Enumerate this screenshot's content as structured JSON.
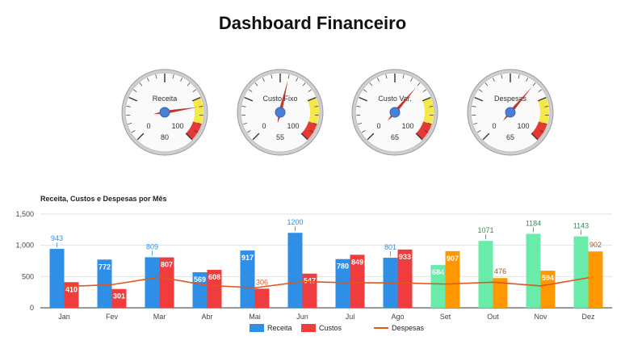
{
  "page": {
    "title": "Dashboard Financeiro"
  },
  "gauges": [
    {
      "label": "Receita",
      "value": 80,
      "min_label": "0",
      "max_label": "100",
      "min": 0,
      "max": 100
    },
    {
      "label": "Custo Fixo",
      "value": 55,
      "min_label": "0",
      "max_label": "100",
      "min": 0,
      "max": 100
    },
    {
      "label": "Custo Var.",
      "value": 65,
      "min_label": "0",
      "max_label": "100",
      "min": 0,
      "max": 100
    },
    {
      "label": "Despesas",
      "value": 65,
      "min_label": "0",
      "max_label": "100",
      "min": 0,
      "max": 100
    }
  ],
  "gauge_colors": {
    "face": "#ffffff",
    "rim": "#888888",
    "needle": "#c0392b",
    "hub": "#4a7fd6",
    "yellow_band": "#f7e84a",
    "red_band": "#e53935",
    "yellow_from": 75,
    "red_from": 90
  },
  "chart_data": {
    "type": "bar",
    "title": "Receita, Custos e Despesas por Mês",
    "categories": [
      "Jan",
      "Fev",
      "Mar",
      "Abr",
      "Mai",
      "Jun",
      "Jul",
      "Ago",
      "Set",
      "Out",
      "Nov",
      "Dez"
    ],
    "ylim": [
      0,
      1500
    ],
    "yticks": [
      0,
      500,
      1000,
      1500
    ],
    "ytick_labels": [
      "0",
      "500",
      "1,000",
      "1,500"
    ],
    "series": [
      {
        "name": "Receita",
        "type": "bar",
        "values": [
          943,
          772,
          809,
          569,
          917,
          1200,
          780,
          801,
          684,
          1071,
          1184,
          1143
        ],
        "colors": [
          "#2f8ee6",
          "#2f8ee6",
          "#2f8ee6",
          "#2f8ee6",
          "#2f8ee6",
          "#2f8ee6",
          "#2f8ee6",
          "#2f8ee6",
          "#69ebaa",
          "#69ebaa",
          "#69ebaa",
          "#69ebaa"
        ]
      },
      {
        "name": "Custos",
        "type": "bar",
        "values": [
          410,
          301,
          807,
          608,
          306,
          547,
          849,
          933,
          907,
          476,
          594,
          902
        ],
        "colors": [
          "#f03c3c",
          "#f03c3c",
          "#f03c3c",
          "#f03c3c",
          "#f03c3c",
          "#f03c3c",
          "#f03c3c",
          "#f03c3c",
          "#ff9800",
          "#ff9800",
          "#ff9800",
          "#ff9800"
        ]
      },
      {
        "name": "Despesas",
        "type": "line",
        "color": "#e0561b",
        "values": [
          340,
          370,
          490,
          360,
          320,
          420,
          400,
          400,
          380,
          410,
          350,
          480
        ]
      }
    ],
    "legend": [
      "Receita",
      "Custos",
      "Despesas"
    ],
    "legend_colors": [
      "#2f8ee6",
      "#f03c3c",
      "#e0561b"
    ],
    "legend_position": "bottom",
    "grid": true
  }
}
